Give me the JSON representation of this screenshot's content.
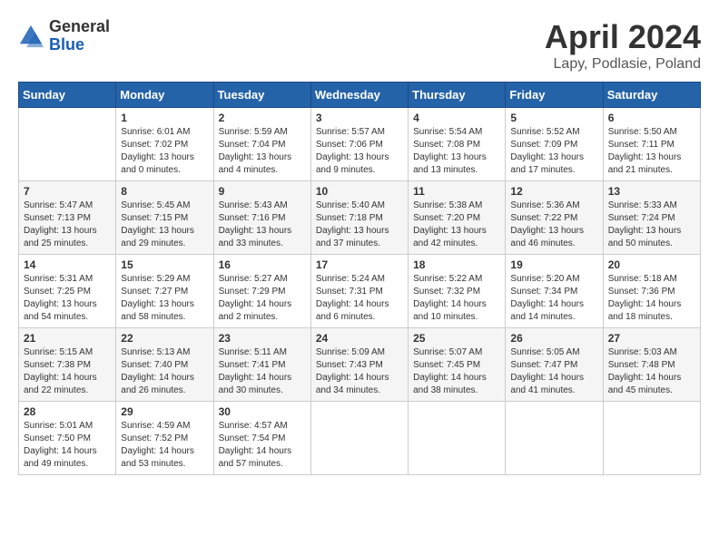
{
  "header": {
    "logo_general": "General",
    "logo_blue": "Blue",
    "title": "April 2024",
    "location": "Lapy, Podlasie, Poland"
  },
  "calendar": {
    "headers": [
      "Sunday",
      "Monday",
      "Tuesday",
      "Wednesday",
      "Thursday",
      "Friday",
      "Saturday"
    ],
    "weeks": [
      [
        {
          "day": "",
          "sunrise": "",
          "sunset": "",
          "daylight": ""
        },
        {
          "day": "1",
          "sunrise": "Sunrise: 6:01 AM",
          "sunset": "Sunset: 7:02 PM",
          "daylight": "Daylight: 13 hours and 0 minutes."
        },
        {
          "day": "2",
          "sunrise": "Sunrise: 5:59 AM",
          "sunset": "Sunset: 7:04 PM",
          "daylight": "Daylight: 13 hours and 4 minutes."
        },
        {
          "day": "3",
          "sunrise": "Sunrise: 5:57 AM",
          "sunset": "Sunset: 7:06 PM",
          "daylight": "Daylight: 13 hours and 9 minutes."
        },
        {
          "day": "4",
          "sunrise": "Sunrise: 5:54 AM",
          "sunset": "Sunset: 7:08 PM",
          "daylight": "Daylight: 13 hours and 13 minutes."
        },
        {
          "day": "5",
          "sunrise": "Sunrise: 5:52 AM",
          "sunset": "Sunset: 7:09 PM",
          "daylight": "Daylight: 13 hours and 17 minutes."
        },
        {
          "day": "6",
          "sunrise": "Sunrise: 5:50 AM",
          "sunset": "Sunset: 7:11 PM",
          "daylight": "Daylight: 13 hours and 21 minutes."
        }
      ],
      [
        {
          "day": "7",
          "sunrise": "Sunrise: 5:47 AM",
          "sunset": "Sunset: 7:13 PM",
          "daylight": "Daylight: 13 hours and 25 minutes."
        },
        {
          "day": "8",
          "sunrise": "Sunrise: 5:45 AM",
          "sunset": "Sunset: 7:15 PM",
          "daylight": "Daylight: 13 hours and 29 minutes."
        },
        {
          "day": "9",
          "sunrise": "Sunrise: 5:43 AM",
          "sunset": "Sunset: 7:16 PM",
          "daylight": "Daylight: 13 hours and 33 minutes."
        },
        {
          "day": "10",
          "sunrise": "Sunrise: 5:40 AM",
          "sunset": "Sunset: 7:18 PM",
          "daylight": "Daylight: 13 hours and 37 minutes."
        },
        {
          "day": "11",
          "sunrise": "Sunrise: 5:38 AM",
          "sunset": "Sunset: 7:20 PM",
          "daylight": "Daylight: 13 hours and 42 minutes."
        },
        {
          "day": "12",
          "sunrise": "Sunrise: 5:36 AM",
          "sunset": "Sunset: 7:22 PM",
          "daylight": "Daylight: 13 hours and 46 minutes."
        },
        {
          "day": "13",
          "sunrise": "Sunrise: 5:33 AM",
          "sunset": "Sunset: 7:24 PM",
          "daylight": "Daylight: 13 hours and 50 minutes."
        }
      ],
      [
        {
          "day": "14",
          "sunrise": "Sunrise: 5:31 AM",
          "sunset": "Sunset: 7:25 PM",
          "daylight": "Daylight: 13 hours and 54 minutes."
        },
        {
          "day": "15",
          "sunrise": "Sunrise: 5:29 AM",
          "sunset": "Sunset: 7:27 PM",
          "daylight": "Daylight: 13 hours and 58 minutes."
        },
        {
          "day": "16",
          "sunrise": "Sunrise: 5:27 AM",
          "sunset": "Sunset: 7:29 PM",
          "daylight": "Daylight: 14 hours and 2 minutes."
        },
        {
          "day": "17",
          "sunrise": "Sunrise: 5:24 AM",
          "sunset": "Sunset: 7:31 PM",
          "daylight": "Daylight: 14 hours and 6 minutes."
        },
        {
          "day": "18",
          "sunrise": "Sunrise: 5:22 AM",
          "sunset": "Sunset: 7:32 PM",
          "daylight": "Daylight: 14 hours and 10 minutes."
        },
        {
          "day": "19",
          "sunrise": "Sunrise: 5:20 AM",
          "sunset": "Sunset: 7:34 PM",
          "daylight": "Daylight: 14 hours and 14 minutes."
        },
        {
          "day": "20",
          "sunrise": "Sunrise: 5:18 AM",
          "sunset": "Sunset: 7:36 PM",
          "daylight": "Daylight: 14 hours and 18 minutes."
        }
      ],
      [
        {
          "day": "21",
          "sunrise": "Sunrise: 5:15 AM",
          "sunset": "Sunset: 7:38 PM",
          "daylight": "Daylight: 14 hours and 22 minutes."
        },
        {
          "day": "22",
          "sunrise": "Sunrise: 5:13 AM",
          "sunset": "Sunset: 7:40 PM",
          "daylight": "Daylight: 14 hours and 26 minutes."
        },
        {
          "day": "23",
          "sunrise": "Sunrise: 5:11 AM",
          "sunset": "Sunset: 7:41 PM",
          "daylight": "Daylight: 14 hours and 30 minutes."
        },
        {
          "day": "24",
          "sunrise": "Sunrise: 5:09 AM",
          "sunset": "Sunset: 7:43 PM",
          "daylight": "Daylight: 14 hours and 34 minutes."
        },
        {
          "day": "25",
          "sunrise": "Sunrise: 5:07 AM",
          "sunset": "Sunset: 7:45 PM",
          "daylight": "Daylight: 14 hours and 38 minutes."
        },
        {
          "day": "26",
          "sunrise": "Sunrise: 5:05 AM",
          "sunset": "Sunset: 7:47 PM",
          "daylight": "Daylight: 14 hours and 41 minutes."
        },
        {
          "day": "27",
          "sunrise": "Sunrise: 5:03 AM",
          "sunset": "Sunset: 7:48 PM",
          "daylight": "Daylight: 14 hours and 45 minutes."
        }
      ],
      [
        {
          "day": "28",
          "sunrise": "Sunrise: 5:01 AM",
          "sunset": "Sunset: 7:50 PM",
          "daylight": "Daylight: 14 hours and 49 minutes."
        },
        {
          "day": "29",
          "sunrise": "Sunrise: 4:59 AM",
          "sunset": "Sunset: 7:52 PM",
          "daylight": "Daylight: 14 hours and 53 minutes."
        },
        {
          "day": "30",
          "sunrise": "Sunrise: 4:57 AM",
          "sunset": "Sunset: 7:54 PM",
          "daylight": "Daylight: 14 hours and 57 minutes."
        },
        {
          "day": "",
          "sunrise": "",
          "sunset": "",
          "daylight": ""
        },
        {
          "day": "",
          "sunrise": "",
          "sunset": "",
          "daylight": ""
        },
        {
          "day": "",
          "sunrise": "",
          "sunset": "",
          "daylight": ""
        },
        {
          "day": "",
          "sunrise": "",
          "sunset": "",
          "daylight": ""
        }
      ]
    ]
  }
}
